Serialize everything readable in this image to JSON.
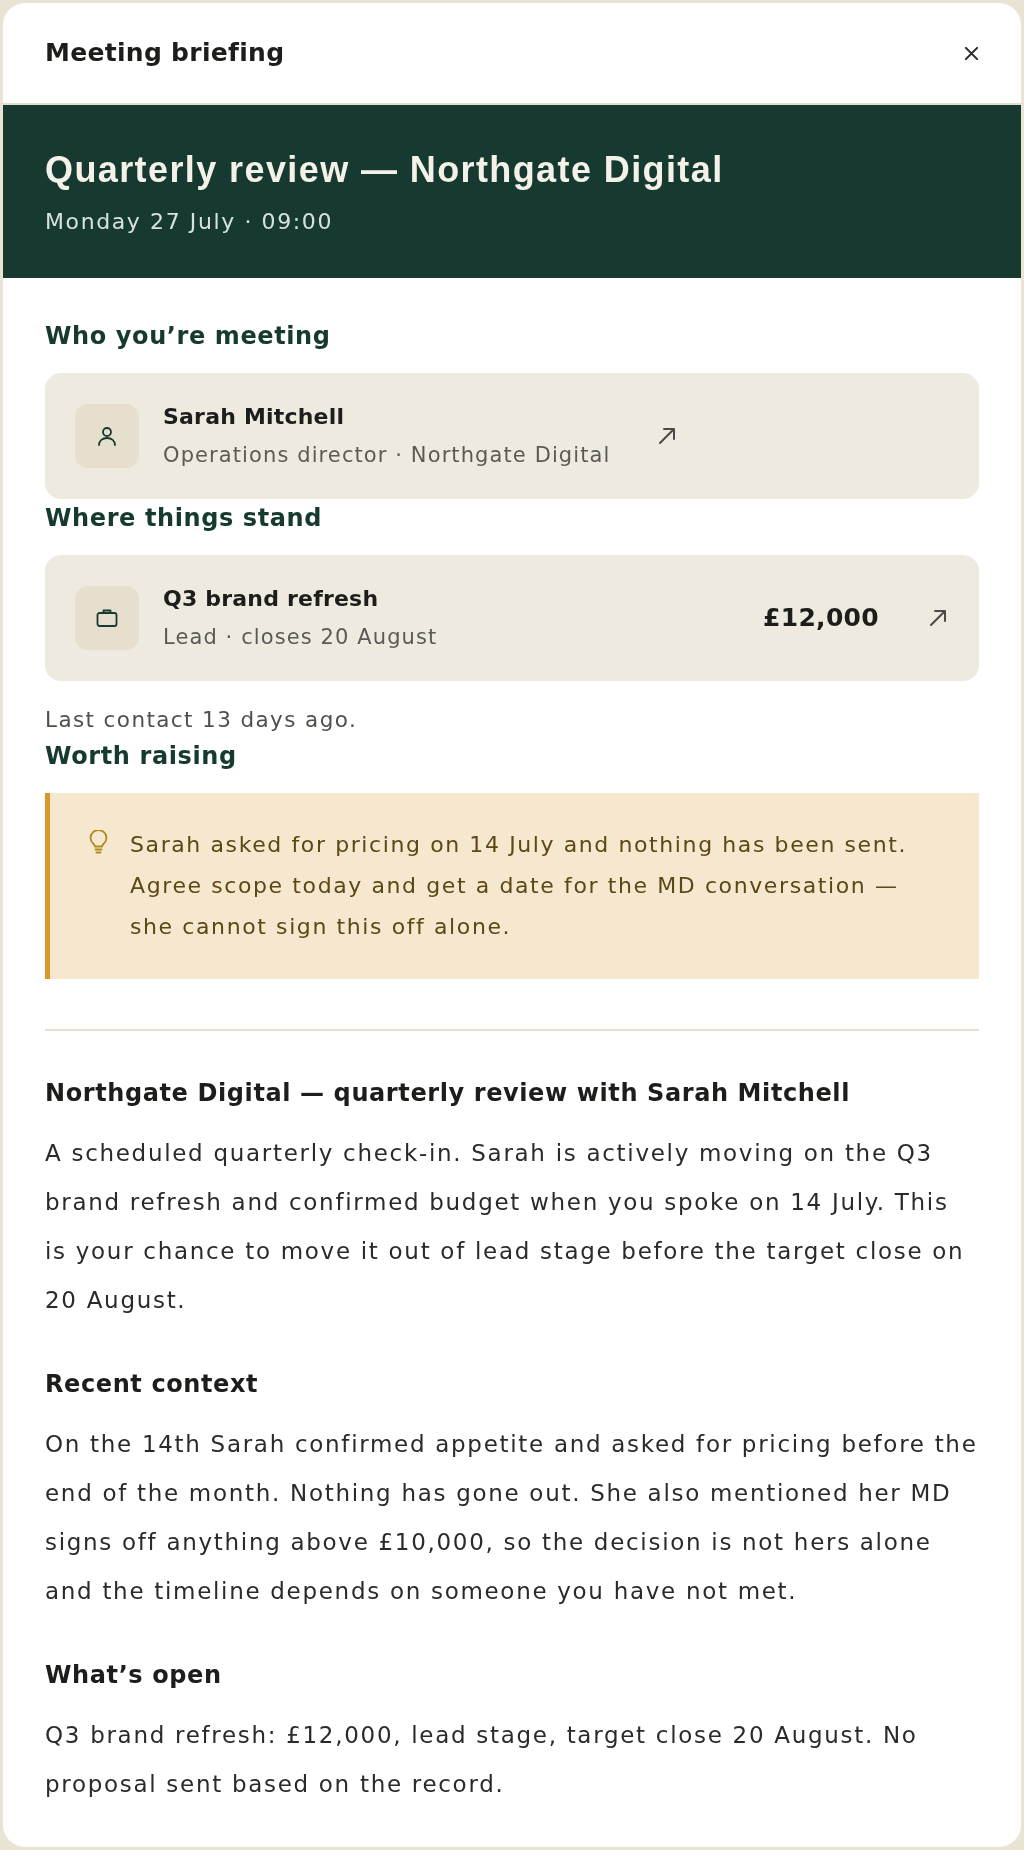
{
  "header": {
    "title": "Meeting briefing"
  },
  "banner": {
    "title": "Quarterly review — Northgate Digital",
    "subtitle": "Monday 27 July · 09:00"
  },
  "people": {
    "heading": "Who you’re meeting",
    "cards": [
      {
        "kind": "person",
        "name": "Sarah Mitchell",
        "detail": "Operations director · Northgate Digital"
      }
    ]
  },
  "standing": {
    "heading": "Where things stand",
    "cards": [
      {
        "kind": "deal",
        "name": "Q3 brand refresh",
        "detail": "Lead · closes 20 August",
        "amount": "£12,000"
      }
    ],
    "note": "Last contact 13 days ago."
  },
  "worth_raising": {
    "heading": "Worth raising",
    "callout": "Sarah asked for pricing on 14 July and nothing has been sent. Agree scope today and get a date for the MD conversation — she cannot sign this off alone."
  },
  "briefing": [
    {
      "heading": "Northgate Digital — quarterly review with Sarah Mitchell",
      "body": "A scheduled quarterly check-in. Sarah is actively moving on the Q3 brand refresh and confirmed budget when you spoke on 14 July. This is your chance to move it out of lead stage before the target close on 20 August."
    },
    {
      "heading": "Recent context",
      "body": "On the 14th Sarah confirmed appetite and asked for pricing before the end of the month. Nothing has gone out. She also mentioned her MD signs off anything above £10,000, so the decision is not hers alone and the timeline depends on someone you have not met."
    },
    {
      "heading": "What’s open",
      "body": "Q3 brand refresh: £12,000, lead stage, target close 20 August. No proposal sent based on the record."
    }
  ]
}
